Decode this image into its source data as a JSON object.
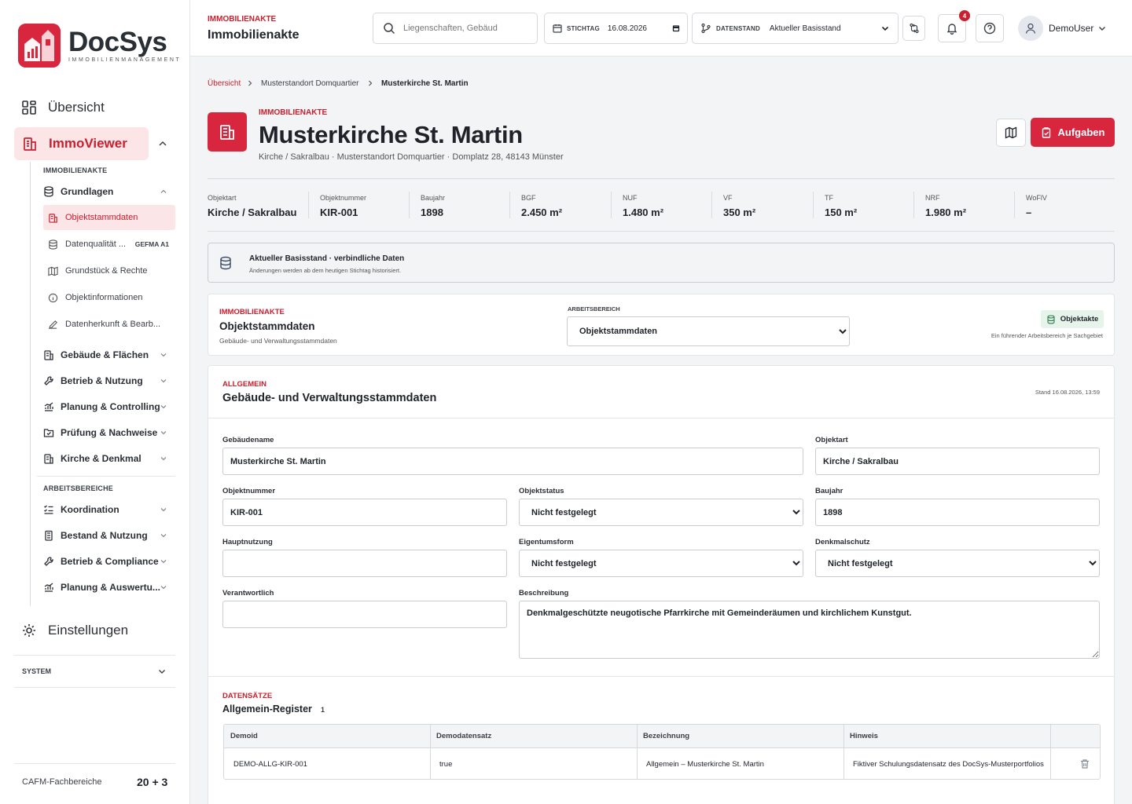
{
  "sidebar": {
    "logo_name": "DocSys",
    "logo_sub": "IMMOBILIENMANAGEMENT",
    "nav_overview": "Übersicht",
    "nav_immoviewer": "ImmoViewer",
    "section_immobilienakte": "IMMOBILIENAKTE",
    "grundlagen": "Grundlagen",
    "leaves": [
      {
        "label": "Objektstammdaten",
        "icon": "building-icon",
        "active": true
      },
      {
        "label": "Datenqualität ...",
        "icon": "database-icon",
        "badge": "GEFMA A1"
      },
      {
        "label": "Grundstück & Rechte",
        "icon": "map-icon"
      },
      {
        "label": "Objektinformationen",
        "icon": "info-icon"
      },
      {
        "label": "Datenherkunft & Bearb...",
        "icon": "pencil-icon"
      }
    ],
    "groups": [
      {
        "label": "Gebäude & Flächen",
        "icon": "building-icon"
      },
      {
        "label": "Betrieb & Nutzung",
        "icon": "wrench-icon"
      },
      {
        "label": "Planung & Controlling",
        "icon": "chart-icon"
      },
      {
        "label": "Prüfung & Nachweise",
        "icon": "check-folder-icon"
      },
      {
        "label": "Kirche & Denkmal",
        "icon": "church-icon"
      }
    ],
    "section_arbeitsbereiche": "ARBEITSBEREICHE",
    "work_groups": [
      {
        "label": "Koordination",
        "icon": "list-check-icon"
      },
      {
        "label": "Bestand & Nutzung",
        "icon": "building-icon"
      },
      {
        "label": "Betrieb & Compliance",
        "icon": "wrench-icon"
      },
      {
        "label": "Planung & Auswertu...",
        "icon": "chart-icon"
      }
    ],
    "nav_settings": "Einstellungen",
    "system": "SYSTEM",
    "cafm_label": "CAFM-Fachbereiche",
    "cafm_count": "20 + 3"
  },
  "topbar": {
    "kicker": "IMMOBILIENAKTE",
    "title": "Immobilienakte",
    "search_placeholder": "Liegenschaften, Gebäude",
    "stichtag_label": "STICHTAG",
    "stichtag_value": "16.08.2026",
    "datenstand_label": "DATENSTAND",
    "datenstand_value": "Aktueller Basisstand",
    "notifications_count": "4",
    "user": "DemoUser"
  },
  "breadcrumb": [
    "Übersicht",
    "Musterstandort Domquartier",
    "Musterkirche St. Martin"
  ],
  "header": {
    "kicker": "IMMOBILIENAKTE",
    "title": "Musterkirche St. Martin",
    "subtitle": "Kirche / Sakralbau · Musterstandort Domquartier · Domplatz 28, 48143 Münster",
    "tasks_label": "Aufgaben"
  },
  "kpis": [
    {
      "label": "Objektart",
      "value": "Kirche / Sakralbau"
    },
    {
      "label": "Objektnummer",
      "value": "KIR-001"
    },
    {
      "label": "Baujahr",
      "value": "1898"
    },
    {
      "label": "BGF",
      "value": "2.450 m²"
    },
    {
      "label": "NUF",
      "value": "1.480 m²"
    },
    {
      "label": "VF",
      "value": "350 m²"
    },
    {
      "label": "TF",
      "value": "150 m²"
    },
    {
      "label": "NRF",
      "value": "1.980 m²"
    },
    {
      "label": "WoFlV",
      "value": "–"
    }
  ],
  "notice": {
    "title": "Aktueller Basisstand · verbindliche Daten",
    "subtitle": "Änderungen werden ab dem heutigen Stichtag historisiert."
  },
  "workspace": {
    "kicker": "IMMOBILIENAKTE",
    "title": "Objektstammdaten",
    "subtitle": "Gebäude- und Verwaltungsstammdaten",
    "select_label": "ARBEITSBEREICH",
    "select_value": "Objektstammdaten",
    "chip": "Objektakte",
    "chip_hint": "Ein führender Arbeitsbereich je Sachgebiet"
  },
  "form": {
    "kicker": "ALLGEMEIN",
    "title": "Gebäude- und Verwaltungsstammdaten",
    "stand": "Stand 16.08.2026, 13:59",
    "fields": {
      "gebaeudename": {
        "label": "Gebäudename",
        "value": "Musterkirche St. Martin"
      },
      "objektart": {
        "label": "Objektart",
        "value": "Kirche / Sakralbau"
      },
      "objektnummer": {
        "label": "Objektnummer",
        "value": "KIR-001"
      },
      "objektstatus": {
        "label": "Objektstatus",
        "value": "Nicht festgelegt"
      },
      "baujahr": {
        "label": "Baujahr",
        "value": "1898"
      },
      "hauptnutzung": {
        "label": "Hauptnutzung",
        "value": ""
      },
      "eigentumsform": {
        "label": "Eigentumsform",
        "value": "Nicht festgelegt"
      },
      "denkmalschutz": {
        "label": "Denkmalschutz",
        "value": "Nicht festgelegt"
      },
      "verantwortlich": {
        "label": "Verantwortlich",
        "value": ""
      },
      "beschreibung": {
        "label": "Beschreibung",
        "value": "Denkmalgeschützte neugotische Pfarrkirche mit Gemeinderäumen und kirchlichem Kunstgut."
      }
    }
  },
  "records": {
    "kicker": "DATENSÄTZE",
    "title": "Allgemein-Register",
    "count": "1",
    "columns": [
      "Demoid",
      "Demodatensatz",
      "Bezeichnung",
      "Hinweis"
    ],
    "rows": [
      [
        "DEMO-ALLG-KIR-001",
        "true",
        "Allgemein – Musterkirche St. Martin",
        "Fiktiver Schulungsdatensatz des DocSys-Musterportfolios"
      ]
    ]
  },
  "colors": {
    "accent": "#d7263d",
    "accent_text": "#c8202f",
    "active_bg": "#fbe5e7",
    "chip_bg": "#e7f4ec"
  }
}
